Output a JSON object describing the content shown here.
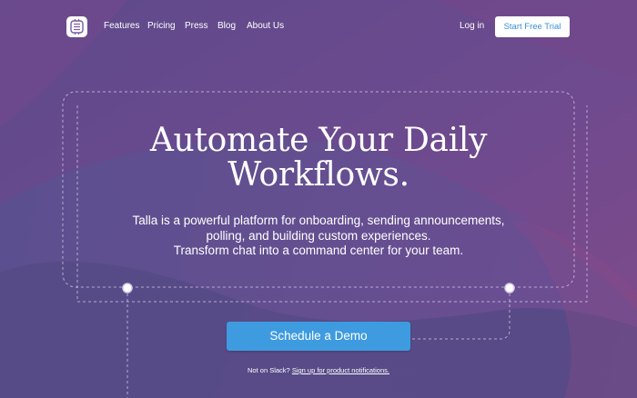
{
  "nav": {
    "links": [
      "Features",
      "Pricing",
      "Press",
      "Blog",
      "About Us"
    ],
    "login_label": "Log in",
    "trial_label": "Start Free Trial"
  },
  "hero": {
    "title_line1": "Automate Your Daily",
    "title_line2": "Workflows.",
    "subtitle_line1": "Talla is a powerful platform for onboarding, sending announcements,",
    "subtitle_line2": "polling, and building custom experiences.",
    "subtitle_line3": "Transform chat into a command center for your team.",
    "cta_label": "Schedule a Demo",
    "note_prefix": "Not on Slack?",
    "note_link": "Sign up for product notifications."
  },
  "colors": {
    "background": "#6a4a8f",
    "cta": "#3e9be0",
    "trial_text": "#3a8fd6"
  },
  "icons": [
    "talla-logo-icon"
  ]
}
